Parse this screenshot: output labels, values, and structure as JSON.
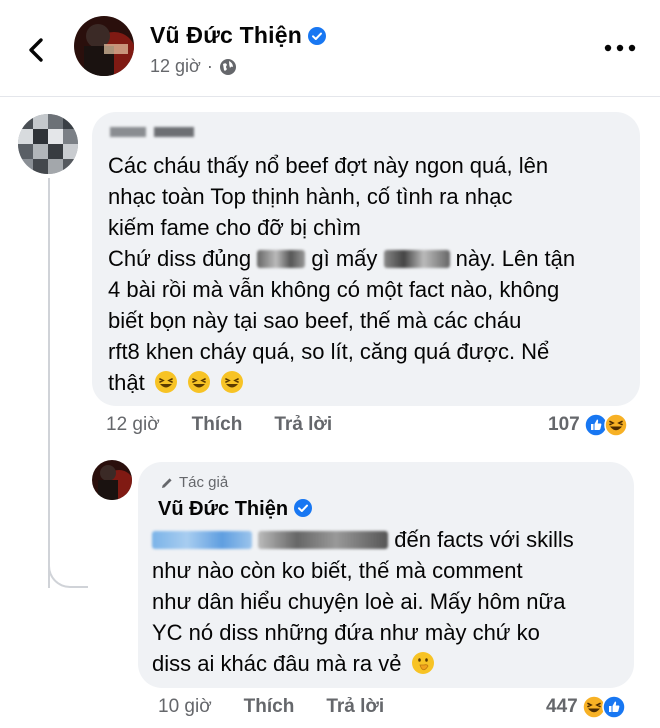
{
  "header": {
    "name": "Vũ Đức Thiện",
    "time": "12 giờ"
  },
  "comment": {
    "lines": [
      "Các cháu thấy nổ beef đợt này ngon quá, lên",
      "nhạc toàn Top thịnh hành, cố tình ra nhạc",
      "kiếm fame cho đỡ bị chìm",
      "Chứ diss đủng",
      "gì mấy",
      "này. Lên tận",
      "4 bài rồi mà vẫn không có một fact nào, không",
      "biết bọn này tại sao beef, thế mà các cháu",
      "rft8 khen cháy quá, so lít, căng quá được. Nể",
      "thật"
    ],
    "time": "12 giờ",
    "like_label": "Thích",
    "reply_label": "Trả lời",
    "reaction_count": "107"
  },
  "reply": {
    "author_tag": "Tác giả",
    "name": "Vũ Đức Thiện",
    "lines": [
      "đến facts với skills",
      "như nào còn ko biết, thế mà comment",
      "như dân hiểu chuyện loè ai. Mấy hôm nữa",
      "YC nó diss những đứa như mày chứ ko",
      "diss ai khác đâu mà ra vẻ"
    ],
    "time": "10 giờ",
    "like_label": "Thích",
    "reply_label": "Trả lời",
    "reaction_count": "447"
  },
  "colors": {
    "bubble": "#f0f2f5",
    "meta": "#65676b",
    "verified": "#1877f2",
    "like": "#1877f2",
    "haha": "#f7b125"
  }
}
